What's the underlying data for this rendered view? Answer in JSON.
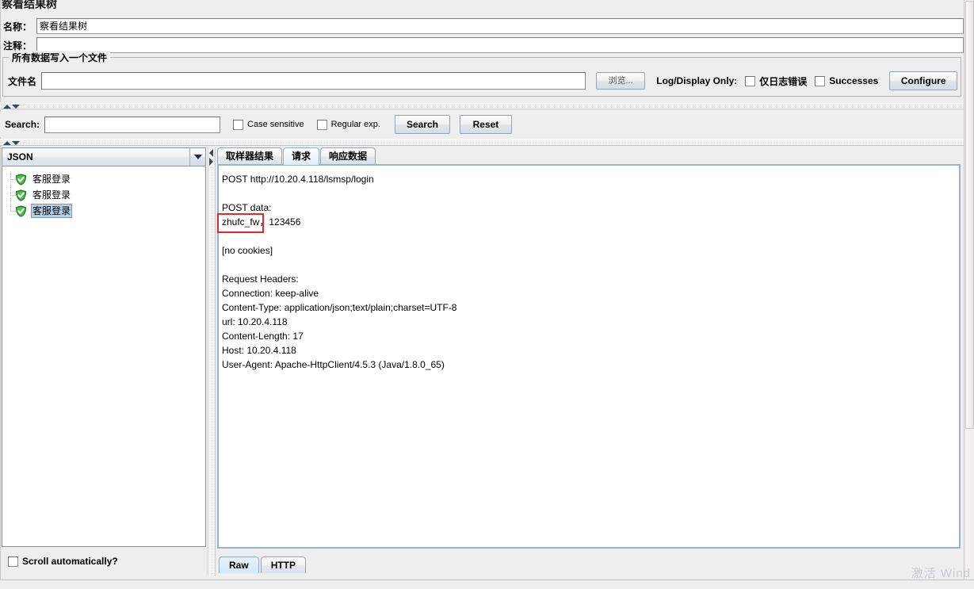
{
  "window": {
    "title": "察看结果树",
    "watermark": "激活 Wind"
  },
  "form": {
    "name_label": "名称：",
    "name_value": "察看结果树",
    "comment_label": "注释：",
    "comment_value": ""
  },
  "file_group": {
    "title": "所有数据写入一个文件",
    "filename_label": "文件名",
    "filename_value": "",
    "filename_placeholder": "",
    "browse_button": "浏览...",
    "log_display_label": "Log/Display Only:",
    "errors_checkbox": "仅日志错误",
    "errors_checked": false,
    "successes_checkbox": "Successes",
    "successes_checked": false,
    "configure_button": "Configure"
  },
  "search": {
    "label": "Search:",
    "value": "",
    "placeholder": "",
    "case_sensitive_label": "Case sensitive",
    "case_sensitive_checked": false,
    "regular_exp_label": "Regular exp.",
    "regular_exp_checked": false,
    "search_button": "Search",
    "reset_button": "Reset"
  },
  "left_panel": {
    "renderer_selected": "JSON",
    "renderer_options": [
      "JSON"
    ],
    "tree_items": [
      {
        "label": "客服登录",
        "status": "success",
        "selected": false
      },
      {
        "label": "客服登录",
        "status": "success",
        "selected": false
      },
      {
        "label": "客服登录",
        "status": "success",
        "selected": true
      }
    ],
    "scroll_automatically_label": "Scroll automatically?",
    "scroll_automatically_checked": false
  },
  "right_panel": {
    "tabs": [
      {
        "label": "取样器结果",
        "active": false
      },
      {
        "label": "请求",
        "active": true
      },
      {
        "label": "响应数据",
        "active": false
      }
    ],
    "request_text": "POST http://10.20.4.118/lsmsp/login\n\nPOST data:\nzhufc_fw，123456\n\n[no cookies]\n\nRequest Headers:\nConnection: keep-alive\nContent-Type: application/json;text/plain;charset=UTF-8\nurl: 10.20.4.118\nContent-Length: 17\nHost: 10.20.4.118\nUser-Agent: Apache-HttpClient/4.5.3 (Java/1.8.0_65)",
    "highlight_annotation": "zhufc_fw，",
    "highlight_color": "#e8262b",
    "bottom_tabs": [
      {
        "label": "Raw",
        "active": true
      },
      {
        "label": "HTTP",
        "active": false
      }
    ]
  }
}
